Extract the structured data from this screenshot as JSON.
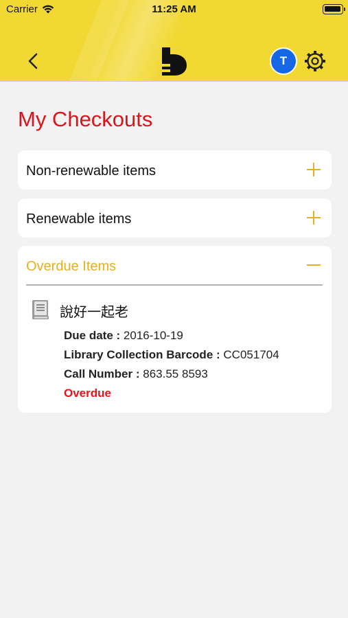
{
  "status_bar": {
    "carrier": "Carrier",
    "time": "11:25 AM",
    "battery_level": 0.85
  },
  "header": {
    "back_icon": "chevron-left-icon",
    "logo_icon": "b-logo-icon",
    "avatar_initial": "T",
    "settings_icon": "gear-icon",
    "colors": {
      "background": "#f2d832",
      "avatar": "#1567e6"
    }
  },
  "page": {
    "title": "My Checkouts",
    "title_color": "#d9141d",
    "accent_color": "#e6b01e"
  },
  "sections": [
    {
      "label": "Non-renewable items",
      "expanded": false,
      "toggle_icon": "plus-icon"
    },
    {
      "label": "Renewable items",
      "expanded": false,
      "toggle_icon": "plus-icon"
    },
    {
      "label": "Overdue Items",
      "expanded": true,
      "toggle_icon": "minus-icon"
    }
  ],
  "overdue_items": [
    {
      "icon": "book-icon",
      "title": "說好一起老",
      "due_date_label": "Due date :",
      "due_date": "2016-10-19",
      "barcode_label": "Library Collection Barcode :",
      "barcode": "CC051704",
      "call_number_label": "Call Number :",
      "call_number": "863.55 8593",
      "status": "Overdue"
    }
  ]
}
